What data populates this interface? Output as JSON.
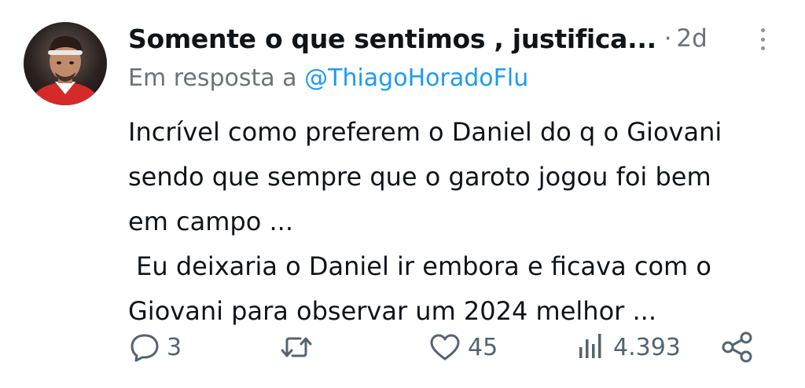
{
  "tweet": {
    "display_name": "Somente o que sentimos , justifica...",
    "separator": "·",
    "timestamp": "2d",
    "reply_prefix": "Em resposta a",
    "reply_handle": "@ThiagoHoradoFlu",
    "body_lines": [
      "Incrível como preferem o Daniel do q o Giovani",
      "sendo que sempre que o garoto jogou foi bem",
      "em campo ...",
      " Eu deixaria o Daniel ir embora e ficava com o",
      "Giovani para observar um 2024 melhor ..."
    ]
  },
  "actions": {
    "reply": {
      "icon": "comment-icon",
      "count": "3"
    },
    "retweet": {
      "icon": "retweet-icon",
      "count": ""
    },
    "like": {
      "icon": "heart-icon",
      "count": "45"
    },
    "views": {
      "icon": "views-chart-icon",
      "count": "4.393"
    },
    "share": {
      "icon": "share-icon"
    }
  },
  "colors": {
    "text": "#0f1419",
    "secondary": "#6b7278",
    "link": "#1d9bf0",
    "icon": "#536471",
    "background": "#ffffff"
  }
}
